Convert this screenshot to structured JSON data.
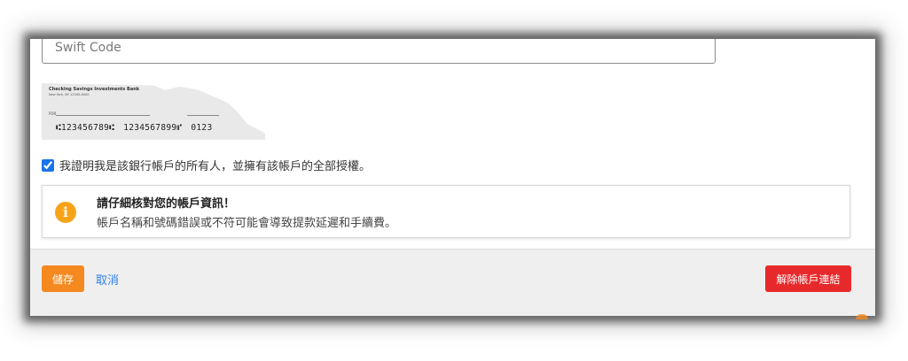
{
  "form": {
    "swift_placeholder": "Swift Code",
    "cheque": {
      "bank_name": "Checking Savings Investments Bank",
      "bank_address": "New York, NY 12345-6000",
      "for_label": "FOR",
      "routing": "⑆123456789⑆",
      "account": "1234567899⑈",
      "check_no": "0123"
    },
    "consent_label": "我證明我是該銀行帳戶的所有人，並擁有該帳戶的全部授權。",
    "consent_checked": true
  },
  "alert": {
    "icon": "info-icon",
    "icon_glyph": "i",
    "title": "請仔細核對您的帳戶資訊！",
    "message": "帳戶名稱和號碼錯誤或不符可能會導致提款延遲和手續費。",
    "icon_color": "#f7a31a"
  },
  "footer": {
    "save_label": "儲存",
    "cancel_label": "取消",
    "unlink_label": "解除帳戶連結",
    "save_color": "#f5891f",
    "unlink_color": "#e8292b",
    "link_color": "#2f80ed"
  }
}
